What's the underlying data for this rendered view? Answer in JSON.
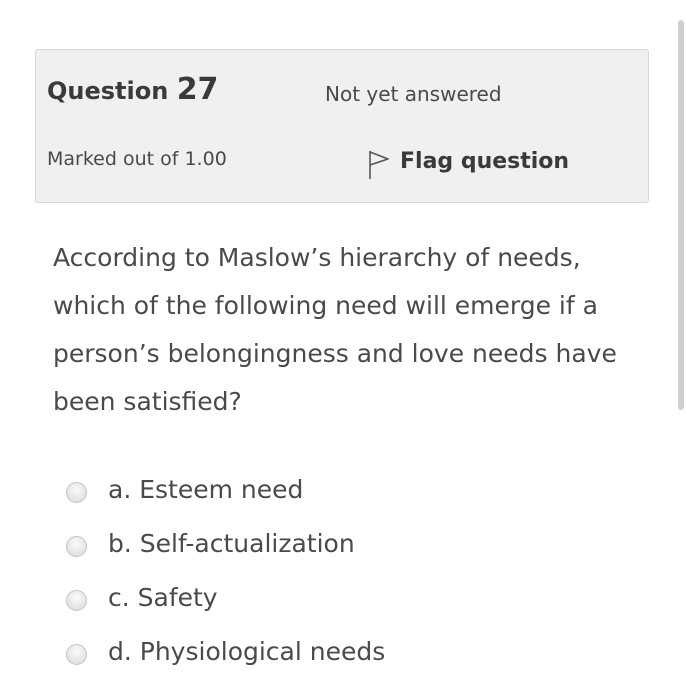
{
  "question_info": {
    "title_prefix": "Question",
    "number": "27",
    "state": "Not yet answered",
    "grade": "Marked out of 1.00",
    "flag_label": "Flag question"
  },
  "question": {
    "text": "According to Maslow’s hierarchy of needs, which of the following need will emerge if a person’s belongingness and love needs have been satisfied?"
  },
  "answers": [
    {
      "label": "a. Esteem need",
      "selected": false
    },
    {
      "label": "b. Self-actualization",
      "selected": false
    },
    {
      "label": "c. Safety",
      "selected": false
    },
    {
      "label": "d. Physiological needs",
      "selected": false
    }
  ]
}
